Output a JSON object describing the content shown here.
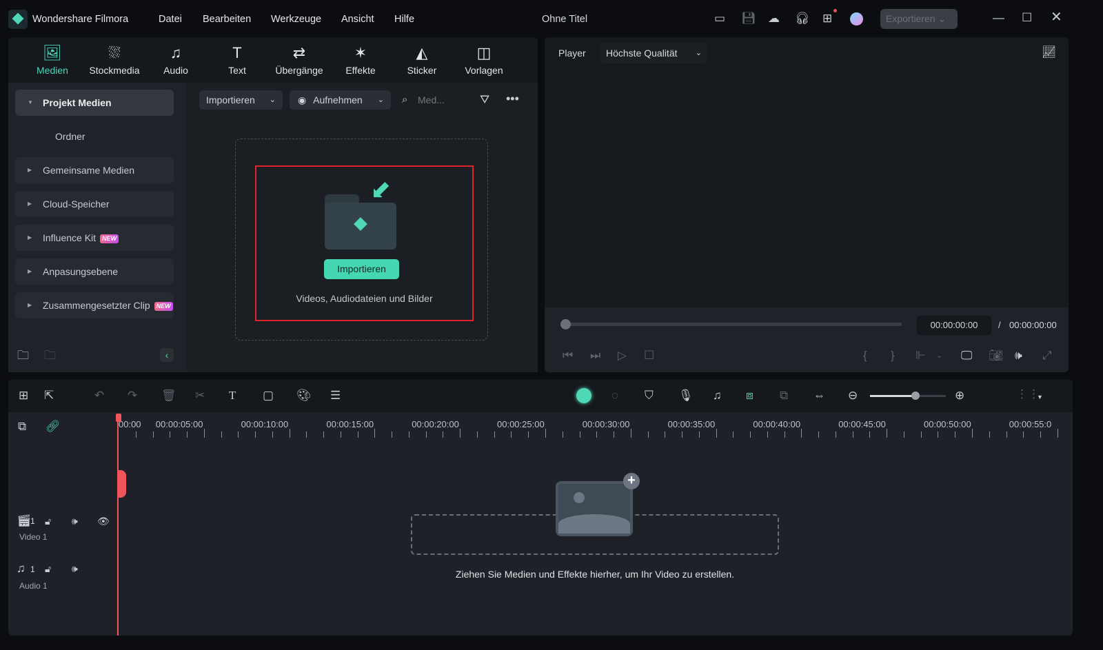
{
  "app": {
    "name": "Wondershare Filmora",
    "project_title": "Ohne Titel",
    "export_label": "Exportieren"
  },
  "menu": [
    "Datei",
    "Bearbeiten",
    "Werkzeuge",
    "Ansicht",
    "Hilfe"
  ],
  "nav_tabs": [
    {
      "label": "Medien",
      "icon": "media-icon",
      "active": true
    },
    {
      "label": "Stockmedia",
      "icon": "stock-icon"
    },
    {
      "label": "Audio",
      "icon": "music-icon"
    },
    {
      "label": "Text",
      "icon": "text-icon"
    },
    {
      "label": "Übergänge",
      "icon": "transition-icon"
    },
    {
      "label": "Effekte",
      "icon": "effects-icon"
    },
    {
      "label": "Sticker",
      "icon": "sticker-icon"
    },
    {
      "label": "Vorlagen",
      "icon": "templates-icon"
    }
  ],
  "sidebar": {
    "items": [
      {
        "label": "Projekt Medien",
        "expanded": true
      },
      {
        "label": "Ordner"
      },
      {
        "label": "Gemeinsame Medien"
      },
      {
        "label": "Cloud-Speicher"
      },
      {
        "label": "Influence Kit",
        "badge": "NEW"
      },
      {
        "label": "Anpasungsebene"
      },
      {
        "label": "Zusammengesetzter Clip",
        "badge": "NEW"
      }
    ]
  },
  "media_toolbar": {
    "import": "Importieren",
    "record": "Aufnehmen",
    "search_placeholder": "Med..."
  },
  "dropzone": {
    "button": "Importieren",
    "hint": "Videos, Audiodateien und Bilder",
    "highlight_color": "#e0242b"
  },
  "player": {
    "label": "Player",
    "quality": "Höchste Qualität",
    "current_time": "00:00:00:00",
    "separator": "/",
    "total_time": "00:00:00:00",
    "progress": 0
  },
  "timeline": {
    "ruler": [
      "00:00",
      "00:00:05:00",
      "00:00:10:00",
      "00:00:15:00",
      "00:00:20:00",
      "00:00:25:00",
      "00:00:30:00",
      "00:00:35:00",
      "00:00:40:00",
      "00:00:45:00",
      "00:00:50:00",
      "00:00:55:0"
    ],
    "tracks": [
      {
        "number": "1",
        "name": "Video 1"
      },
      {
        "number": "1",
        "name": "Audio 1"
      }
    ],
    "empty_hint": "Ziehen Sie Medien und Effekte hierher, um Ihr Video zu erstellen.",
    "zoom_level": 0.6
  },
  "colors": {
    "accent": "#4fd8b5",
    "playhead": "#f0545c",
    "background": "#1e2228"
  }
}
